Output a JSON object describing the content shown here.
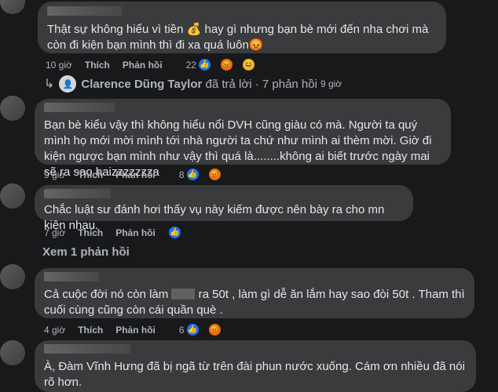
{
  "comments": [
    {
      "text": "Thật sự không hiểu vì tiền 💰 hay gì nhưng bạn bè mới đến nha chơi mà còn đi kiện bạn mình thì đi xa quá luôn😡",
      "time": "10 giờ",
      "like_label": "Thích",
      "reply_label": "Phản hồi",
      "reaction_count": "22",
      "reactions": [
        "like-icon",
        "angry-icon",
        "haha-icon"
      ]
    },
    {
      "text": "Bạn bè kiểu vậy thì không hiểu nổi DVH cũng giàu có mà. Người ta quý mình họ mới mời mình tới nhà người ta chứ như mình ai thèm mời. Giờ đi kiện ngược bạn mình như vậy thì quá là........không ai biết trước ngày mai sẽ ra sao haizzzzzzza",
      "time": "9 giờ",
      "like_label": "Thích",
      "reply_label": "Phản hồi",
      "reaction_count": "8",
      "reactions": [
        "like-icon",
        "angry-icon"
      ]
    },
    {
      "text": "Chắc luật sư đánh hơi thấy vụ này kiếm được nên bày ra cho mn kiện nhau.",
      "time": "7 giờ",
      "like_label": "Thích",
      "reply_label": "Phản hồi",
      "reaction_count": "",
      "reactions": [
        "like-icon"
      ]
    },
    {
      "text_before": "Cả cuộc đời nó còn làm",
      "text_after": "ra 50t , làm gì dễ ăn lắm hay sao đòi 50t . Tham thì cuối cùng cũng còn cái quần què .",
      "time": "4 giờ",
      "like_label": "Thích",
      "reply_label": "Phản hồi",
      "reaction_count": "6",
      "reactions": [
        "like-icon",
        "angry-icon"
      ]
    },
    {
      "text": "À, Đàm Vĩnh Hưng đã bị ngã từ trên đài phun nước xuống. Cám ơn nhiều đã nói rõ hơn."
    }
  ],
  "reply_summary": {
    "name": "Clarence Dũng Taylor",
    "action": "đã trả lời",
    "count": "· 7 phản hồi",
    "time": "9 giờ"
  },
  "view_replies": "Xem 1 phản hồi",
  "colors": {
    "background": "#18191a",
    "bubble": "#3a3b3c",
    "text": "#e4e6eb",
    "secondary": "#b0b3b8",
    "like": "#1877f2",
    "angry": "#e9710f"
  }
}
